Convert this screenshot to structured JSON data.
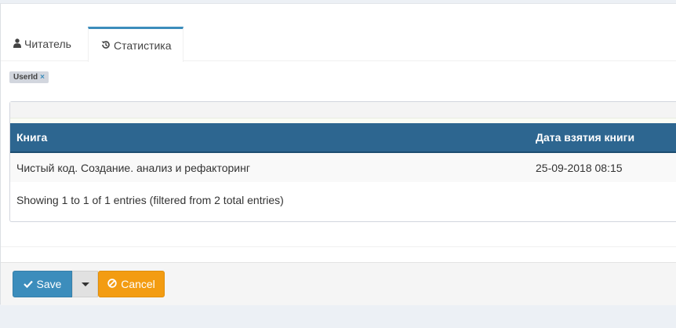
{
  "tabs": [
    {
      "label": "Читатель",
      "icon": "user-icon"
    },
    {
      "label": "Статистика",
      "icon": "history-icon",
      "active": true
    }
  ],
  "filter_chip": {
    "label": "UserId",
    "remove": "×"
  },
  "table": {
    "columns": [
      "Книга",
      "Дата взятия книги"
    ],
    "rows": [
      [
        "Чистый код. Создание. анализ и рефакторинг",
        "25-09-2018 08:15"
      ]
    ],
    "info": "Showing 1 to 1 of 1 entries (filtered from 2 total entries)"
  },
  "footer": {
    "save_label": "Save",
    "cancel_label": "Cancel"
  },
  "colors": {
    "accent": "#3c8dbc",
    "table_header": "#2d6690",
    "cancel": "#f39c12"
  }
}
